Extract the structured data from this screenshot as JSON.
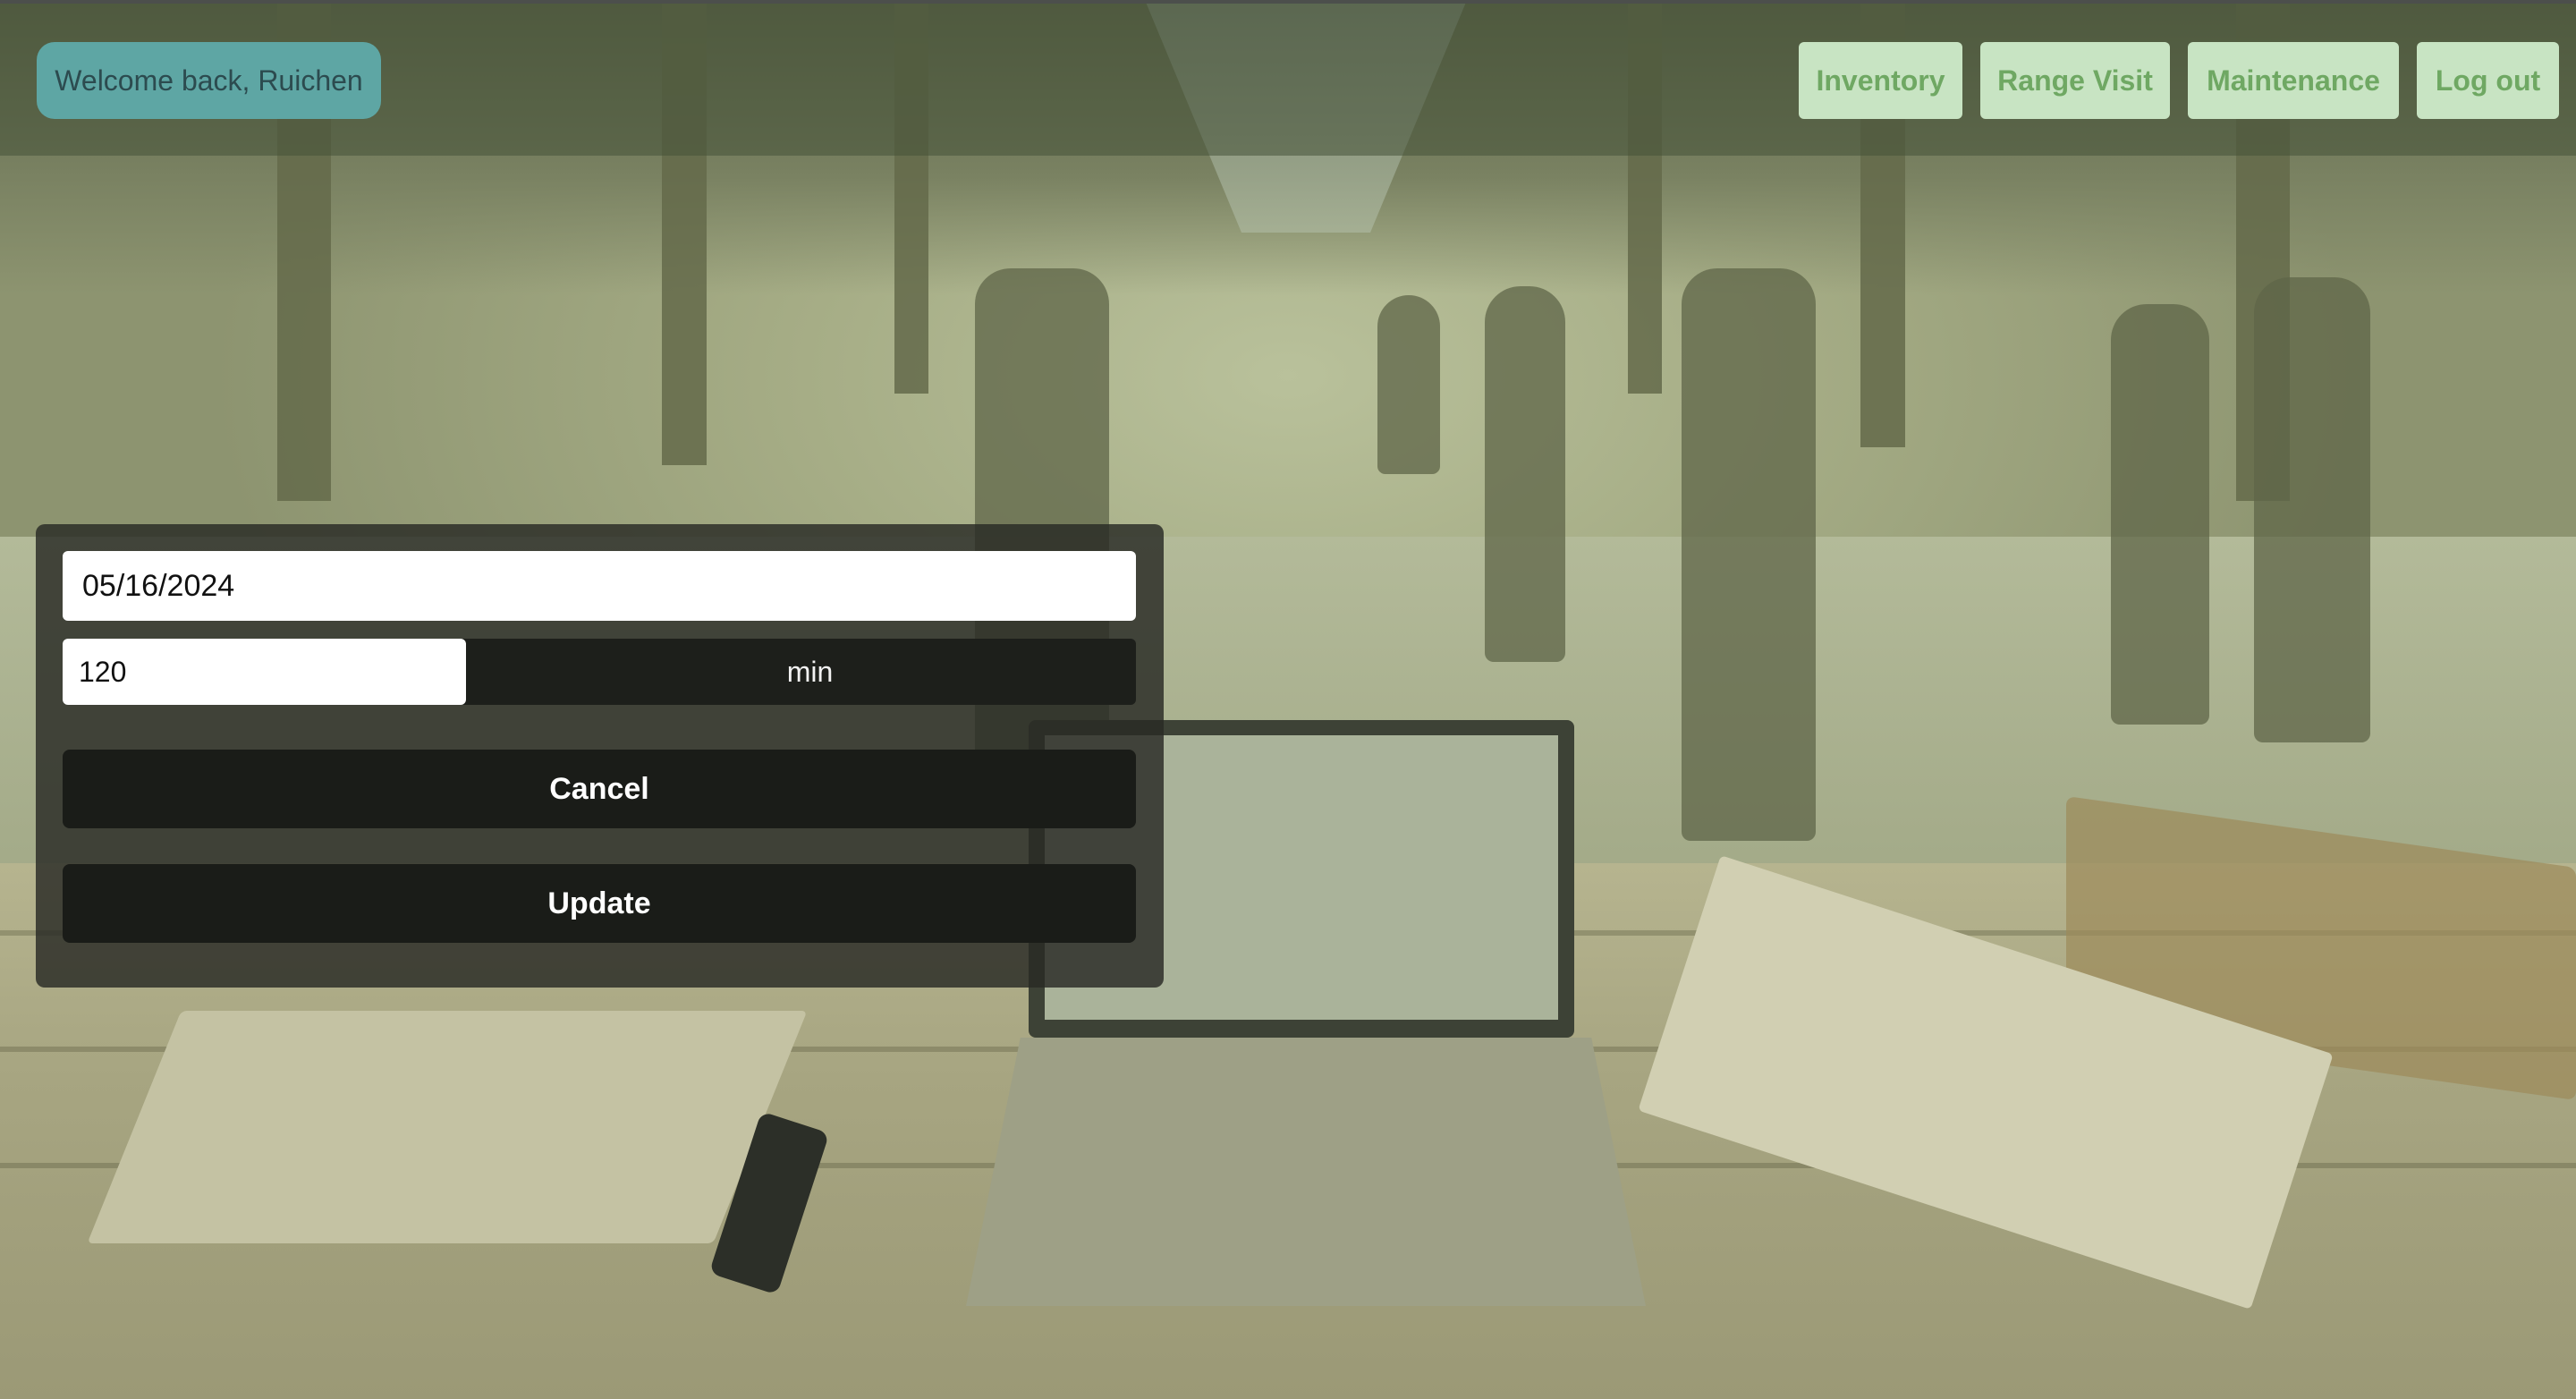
{
  "header": {
    "welcome_text": "Welcome back, Ruichen",
    "nav": {
      "inventory": "Inventory",
      "range_visit": "Range Visit",
      "maintenance": "Maintenance",
      "logout": "Log out"
    }
  },
  "form": {
    "date_value": "05/16/2024",
    "duration_value": "120",
    "duration_unit": "min",
    "cancel_label": "Cancel",
    "update_label": "Update"
  },
  "colors": {
    "welcome_bg": "#5ea6a4",
    "nav_bg": "#c8e4c3",
    "nav_text": "#6fa863",
    "panel_bg": "#282a24",
    "button_bg": "#1a1c18"
  },
  "background": {
    "description_icon": "indoor-shooting-range-photo"
  }
}
